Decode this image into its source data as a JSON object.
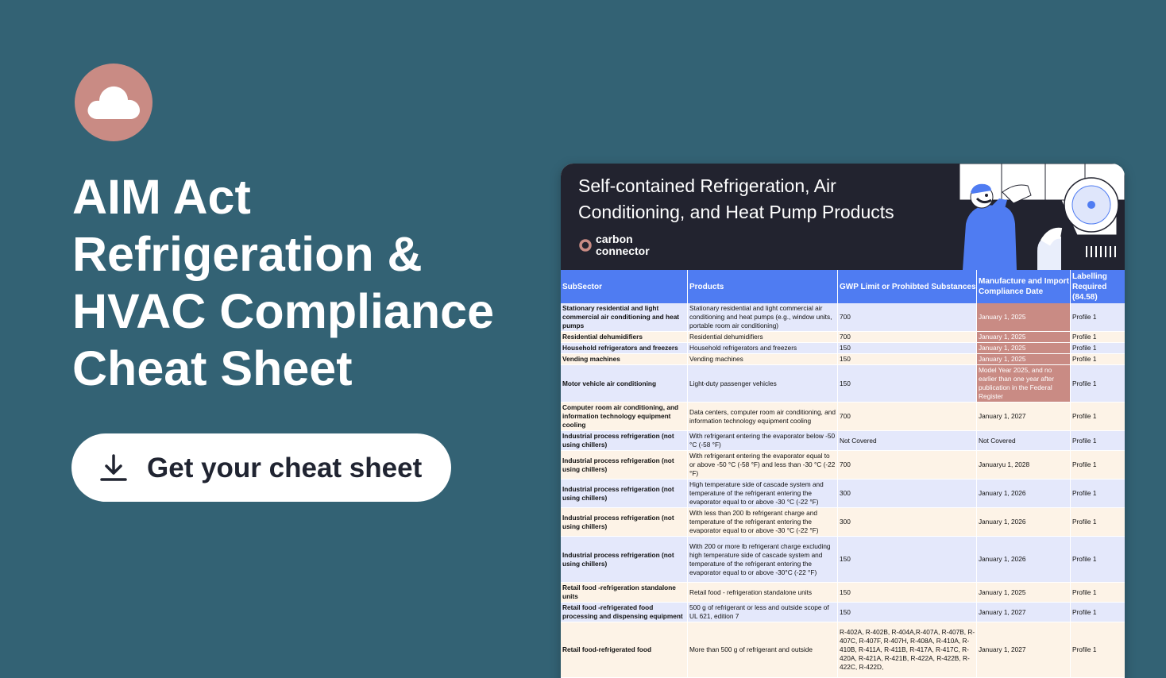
{
  "headline": [
    "AIM Act",
    "Refrigeration &",
    "HVAC Compliance",
    "Cheat Sheet"
  ],
  "cta": {
    "label": "Get your cheat sheet"
  },
  "card": {
    "title": "Self-contained Refrigeration, Air Conditioning, and Heat Pump Products",
    "brand": [
      "carbon",
      "connector"
    ],
    "columns": [
      "SubSector",
      "Products",
      "GWP Limit or Prohibted Substances",
      "Manufacture and Import Compliance Date",
      "Labelling Required (84.58)"
    ],
    "rows": [
      {
        "sub": "Stationary residential and light commercial air conditioning and heat pumps",
        "prod": "Stationary residential and light commercial air conditioning and heat pumps (e.g., window units, portable room air conditioning)",
        "gwp": "700",
        "date": "January 1, 2025",
        "label": "Profile 1",
        "h": 36,
        "hl": true
      },
      {
        "sub": "Residential dehumidifiers",
        "prod": "Residential dehumidifiers",
        "gwp": "700",
        "date": "January 1, 2025",
        "label": "Profile 1",
        "h": 14,
        "hl": true
      },
      {
        "sub": "Household refrigerators and freezers",
        "prod": "Household refrigerators and freezers",
        "gwp": "150",
        "date": "January 1, 2025",
        "label": "Profile 1",
        "h": 14,
        "hl": true
      },
      {
        "sub": "Vending machines",
        "prod": "Vending machines",
        "gwp": "150",
        "date": "January 1, 2025",
        "label": "Profile 1",
        "h": 14,
        "hl": true
      },
      {
        "sub": "Motor vehicle air conditioning",
        "prod": "Light-duty passenger vehicles",
        "gwp": "150",
        "date": "Model Year 2025, and no earlier than one year after publication in the Federal Register",
        "label": "Profile 1",
        "h": 47,
        "hl": true
      },
      {
        "sub": "Computer room air conditioning, and information technology equipment cooling",
        "prod": "Data centers, computer room air conditioning, and information technology equipment cooling",
        "gwp": "700",
        "date": "January 1, 2027",
        "label": "Profile 1",
        "h": 36,
        "hl": false
      },
      {
        "sub": "Industrial process refrigeration (not using chillers)",
        "prod": "With refrigerant entering the evaporator below -50 °C (-58 °F)",
        "gwp": "Not Covered",
        "date": "Not Covered",
        "label": "Profile 1",
        "h": 25,
        "hl": false
      },
      {
        "sub": "Industrial process refrigeration (not using chillers)",
        "prod": "With refrigerant entering the evaporator equal to or above -50 °C (-58 °F) and less than -30 °C (-22 °F)",
        "gwp": "700",
        "date": "Januaryu 1, 2028",
        "label": "Profile 1",
        "h": 36,
        "hl": false
      },
      {
        "sub": "Industrial process refrigeration (not using chillers)",
        "prod": "High temperature side of cascade system and temperature of the refrigerant entering the evaporator equal to or above -30 °C (-22 °F)",
        "gwp": "300",
        "date": "January 1, 2026",
        "label": "Profile 1",
        "h": 36,
        "hl": false
      },
      {
        "sub": "Industrial process refrigeration (not using chillers)",
        "prod": "With less than 200 lb refrigerant charge and temperature of the refrigerant entering the evaporator equal to or above -30 °C (-22 °F)",
        "gwp": "300",
        "date": "January 1, 2026",
        "label": "Profile 1",
        "h": 36,
        "hl": false
      },
      {
        "sub": "Industrial process refrigeration (not using chillers)",
        "prod": "With 200 or more lb refrigerant charge excluding high temperature side of cascade system and temperature of the refrigerant entering the evaporator equal to or above -30°C (-22 °F)",
        "gwp": "150",
        "date": "January 1, 2026",
        "label": "Profile 1",
        "h": 58,
        "hl": false
      },
      {
        "sub": "Retail food -refrigeration standalone units",
        "prod": "Retail food - refrigeration standalone units",
        "gwp": "150",
        "date": "January 1, 2025",
        "label": "Profile 1",
        "h": 25,
        "hl": false
      },
      {
        "sub": "Retail food -refrigerated food processing and dispensing equipment",
        "prod": "500 g of refrigerant or less and outside scope of UL 621, edition 7",
        "gwp": "150",
        "date": "January 1, 2027",
        "label": "Profile 1",
        "h": 25,
        "hl": false
      },
      {
        "sub": "Retail food-refrigerated food",
        "prod": "More than 500 g of refrigerant and outside",
        "gwp": "R-402A, R-402B, R-404A,R-407A, R-407B, R-407C, R-407F, R-407H, R-408A, R-410A, R-410B, R-411A, R-411B, R-417A, R-417C, R-420A, R-421A, R-421B, R-422A, R-422B, R-422C, R-422D,",
        "date": "January 1, 2027",
        "label": "Profile 1",
        "h": 70,
        "hl": false
      }
    ]
  }
}
